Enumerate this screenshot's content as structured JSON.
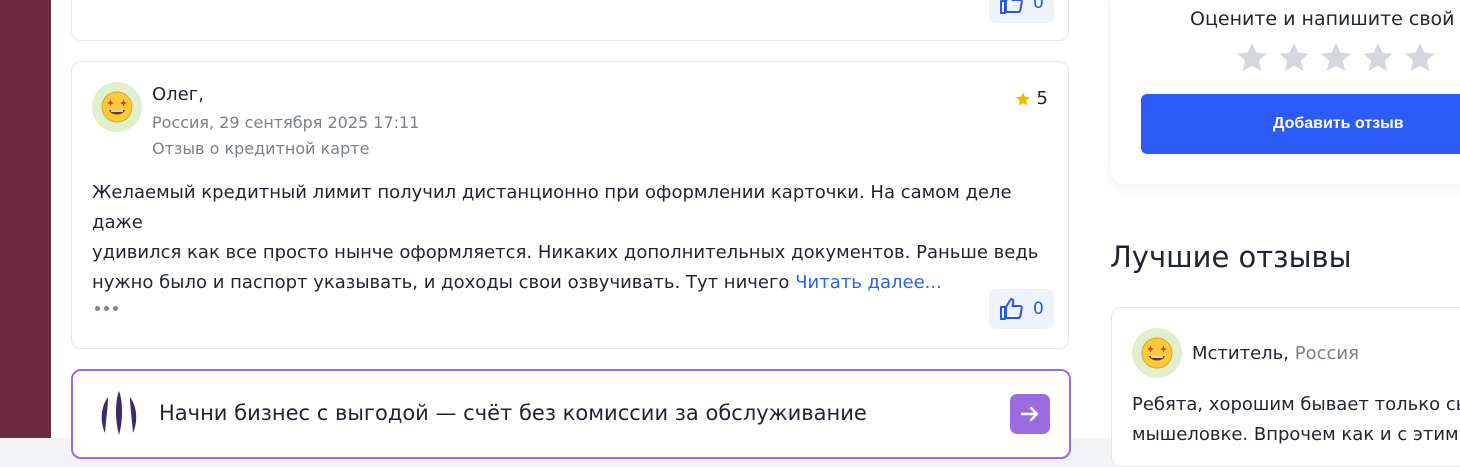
{
  "top_card": {
    "likes": "0"
  },
  "review": {
    "author": "Олег,",
    "meta_line": "Россия, 29 сентября 2025 17:11",
    "kind": "Отзыв о кредитной карте",
    "rating": "5",
    "text_lines": [
      "Желаемый кредитный лимит получил дистанционно при оформлении карточки. На самом деле даже",
      "удивился как все просто нынче оформляется. Никаких дополнительных документов. Раньше ведь",
      "нужно было и паспорт указывать, и доходы свои озвучивать. Тут ничего"
    ],
    "read_more": "Читать далее...",
    "likes": "0"
  },
  "promo": {
    "text": "Начни бизнес с выгодой — счёт без комиссии за обслуживание",
    "accent": "#9b6be0"
  },
  "rate_panel": {
    "title": "Оцените и напишите свой от",
    "star_count": 5,
    "add_button": "Добавить отзыв",
    "button_color": "#2c5bf5"
  },
  "best_reviews": {
    "heading": "Лучшие отзывы",
    "first": {
      "author": "Мститель,",
      "country": "Россия",
      "text_lines": [
        "Ребята, хорошим бывает только сыр",
        "мышеловке. Впрочем как и с этим б"
      ]
    }
  },
  "colors": {
    "side_strip": "#6b2a3f",
    "link": "#2f63e4",
    "star_active": "#f5b800",
    "star_inactive": "#d4d7de"
  },
  "icons": [
    "thumbs-up-icon",
    "more-dots-icon",
    "star-icon",
    "avatar-emoji-icon",
    "arrow-right-icon",
    "bank-logo-icon"
  ]
}
